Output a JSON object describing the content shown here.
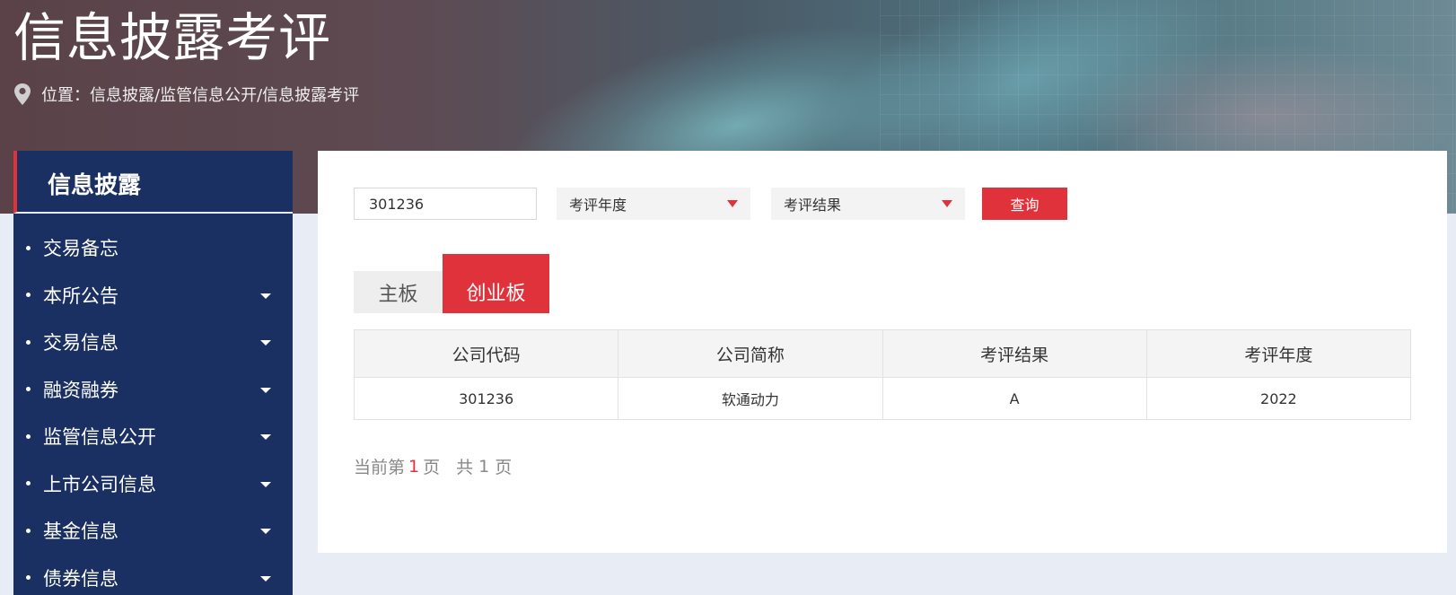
{
  "header": {
    "title": "信息披露考评",
    "breadcrumb": "位置：信息披露/监管信息公开/信息披露考评"
  },
  "sidebar": {
    "title": "信息披露",
    "items": [
      {
        "label": "交易备忘",
        "expandable": false
      },
      {
        "label": "本所公告",
        "expandable": true
      },
      {
        "label": "交易信息",
        "expandable": true
      },
      {
        "label": "融资融券",
        "expandable": true
      },
      {
        "label": "监管信息公开",
        "expandable": true
      },
      {
        "label": "上市公司信息",
        "expandable": true
      },
      {
        "label": "基金信息",
        "expandable": true
      },
      {
        "label": "债券信息",
        "expandable": true
      }
    ]
  },
  "search": {
    "code_value": "301236",
    "year_select": "考评年度",
    "result_select": "考评结果",
    "query_label": "查询"
  },
  "tabs": {
    "main": "主板",
    "gem": "创业板",
    "active": "gem"
  },
  "table": {
    "headers": [
      "公司代码",
      "公司简称",
      "考评结果",
      "考评年度"
    ],
    "rows": [
      [
        "301236",
        "软通动力",
        "A",
        "2022"
      ]
    ]
  },
  "pager": {
    "prefix": "当前第",
    "current": "1",
    "page_unit": "页",
    "total_prefix": "共",
    "total": "1",
    "total_unit": "页"
  },
  "colors": {
    "accent": "#e0323a",
    "sidebar_bg": "#1a2f62",
    "page_bg": "#e8ecf4"
  }
}
